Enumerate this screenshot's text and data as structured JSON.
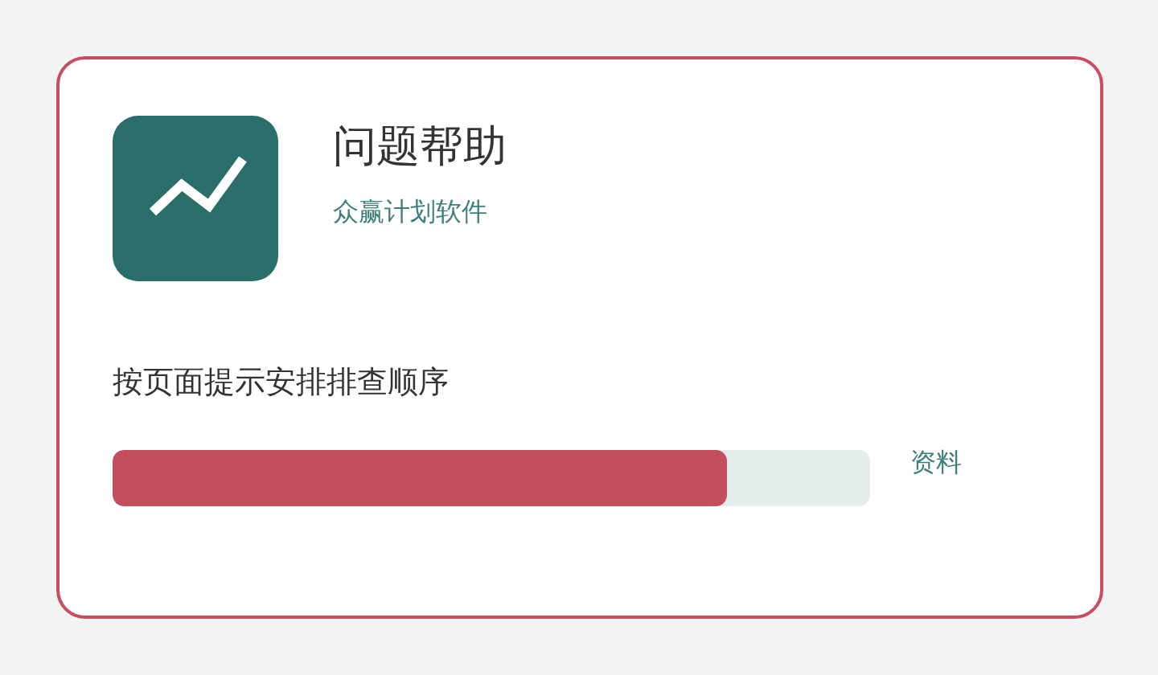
{
  "app": {
    "title": "问题帮助",
    "subtitle": "众赢计划软件"
  },
  "instruction": "按页面提示安排排查顺序",
  "progress": {
    "level": 0.81,
    "label": "资料"
  }
}
